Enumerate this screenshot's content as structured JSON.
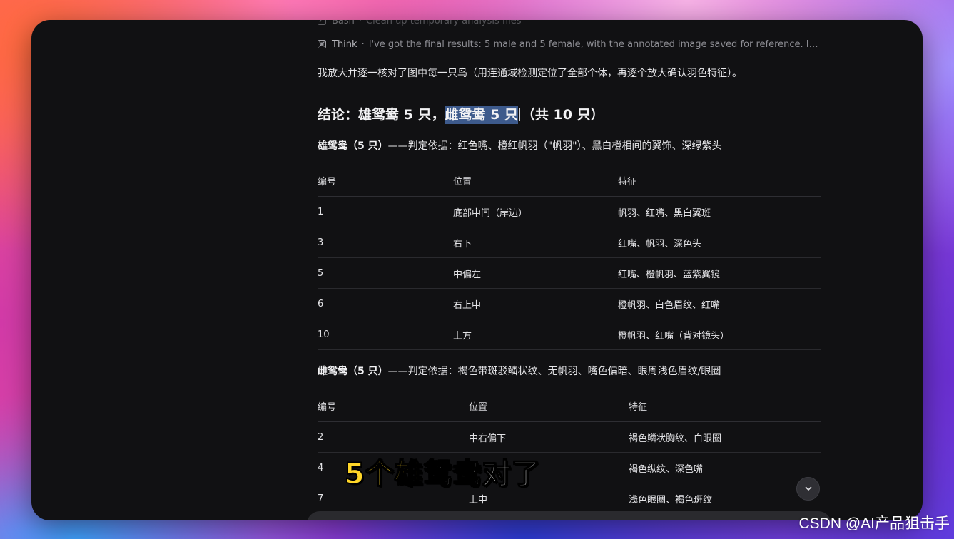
{
  "activity": {
    "bash": {
      "label": "Bash",
      "text": "Clean up temporary analysis files"
    },
    "think": {
      "label": "Think",
      "separator": "·",
      "text": "I've got the final results: 5 male and 5 female, with the annotated image saved for reference. I'll note th..."
    }
  },
  "intro": "我放大并逐一核对了图中每一只鸟（用连通域检测定位了全部个体，再逐个放大确认羽色特征）。",
  "conclusion": {
    "prefix": "结论：雄鸳鸯 5 只，",
    "highlighted": "雌鸳鸯 5 只",
    "suffix": "（共 10 只）"
  },
  "male": {
    "title_bold": "雄鸳鸯（5 只）",
    "title_rest": "——判定依据：红色嘴、橙红帆羽（\"帆羽\"）、黑白橙相间的翼饰、深绿紫头",
    "headers": [
      "编号",
      "位置",
      "特征"
    ],
    "rows": [
      [
        "1",
        "底部中间（岸边）",
        "帆羽、红嘴、黑白翼斑"
      ],
      [
        "3",
        "右下",
        "红嘴、帆羽、深色头"
      ],
      [
        "5",
        "中偏左",
        "红嘴、橙帆羽、蓝紫翼镜"
      ],
      [
        "6",
        "右上中",
        "橙帆羽、白色眉纹、红嘴"
      ],
      [
        "10",
        "上方",
        "橙帆羽、红嘴（背对镜头）"
      ]
    ]
  },
  "female": {
    "title_bold": "雌鸳鸯（5 只）",
    "title_rest": "——判定依据：褐色带斑驳鳞状纹、无帆羽、嘴色偏暗、眼周浅色眉纹/眼圈",
    "headers": [
      "编号",
      "位置",
      "特征"
    ],
    "rows": [
      [
        "2",
        "中右偏下",
        "褐色鳞状胸纹、白眼圈"
      ],
      [
        "4",
        "",
        "褐色纵纹、深色嘴"
      ],
      [
        "7",
        "上中",
        "浅色眼圈、褐色斑纹"
      ]
    ]
  },
  "subtitle": {
    "yellow": "5个雄",
    "white": "鸳鸯对了"
  },
  "watermark": "CSDN @AI产品狙击手",
  "icons": {
    "think": "think-icon",
    "bash": "terminal-icon",
    "scroll": "chevron-down-icon"
  }
}
